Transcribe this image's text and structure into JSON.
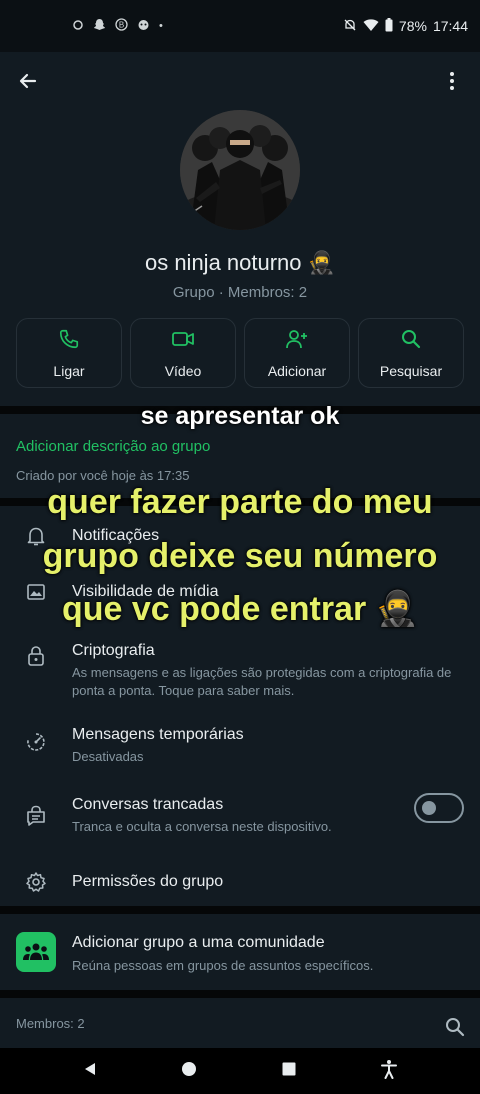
{
  "status_bar": {
    "notif_icons": [
      "notification-icon",
      "snapchat-icon",
      "b-app-icon",
      "puppy-app-icon"
    ],
    "dot": "•",
    "battery": "78%",
    "time": "17:44"
  },
  "appbar": {
    "back_icon": "arrow-left-icon",
    "menu_icon": "more-vert-icon"
  },
  "group": {
    "name": "os ninja noturno 🥷",
    "meta": "Grupo · Membros: 2"
  },
  "actions": [
    {
      "label": "Ligar",
      "icon": "phone-icon"
    },
    {
      "label": "Vídeo",
      "icon": "video-icon"
    },
    {
      "label": "Adicionar",
      "icon": "add-person-icon"
    },
    {
      "label": "Pesquisar",
      "icon": "search-icon"
    }
  ],
  "description": {
    "add_label": "Adicionar descrição ao grupo",
    "created": "Criado por você hoje às 17:35"
  },
  "settings": {
    "notifications": "Notificações",
    "media_visibility": "Visibilidade de mídia",
    "encryption_title": "Criptografia",
    "encryption_sub": "As mensagens e as ligações são protegidas com a criptografia de ponta a ponta. Toque para saber mais.",
    "temp_title": "Mensagens temporárias",
    "temp_sub": "Desativadas",
    "locked_title": "Conversas trancadas",
    "locked_sub": "Tranca e oculta a conversa neste dispositivo.",
    "locked_enabled": false,
    "permissions": "Permissões do grupo"
  },
  "community": {
    "title": "Adicionar grupo a uma comunidade",
    "sub": "Reúna pessoas em grupos de assuntos específicos."
  },
  "members": {
    "label": "Membros: 2"
  },
  "overlay": {
    "white_text": "se apresentar ok",
    "yellow_line1": "quer fazer parte do meu",
    "yellow_line2": "grupo deixe seu número",
    "yellow_line3": "que vc pode entrar 🥷"
  },
  "colors": {
    "accent": "#21c063",
    "background": "#121b22",
    "overlay_yellow": "#e5f06a"
  }
}
